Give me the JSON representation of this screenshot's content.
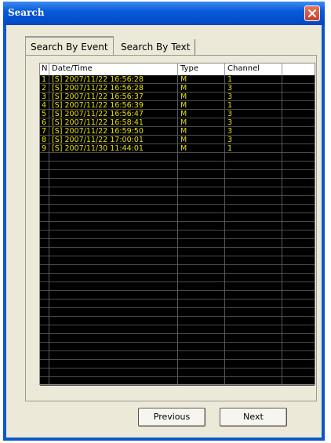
{
  "window": {
    "title": "Search"
  },
  "tabs": [
    {
      "label": "Search By Event",
      "active": true
    },
    {
      "label": "Search By Text",
      "active": false
    }
  ],
  "table": {
    "columns": [
      "N",
      "Date/Time",
      "Type",
      "Channel",
      ""
    ],
    "rows": [
      [
        "1",
        "[S] 2007/11/22 16:56:28",
        "M",
        "1"
      ],
      [
        "2",
        "[S] 2007/11/22 16:56:28",
        "M",
        "3"
      ],
      [
        "3",
        "[S] 2007/11/22 16:56:37",
        "M",
        "3"
      ],
      [
        "4",
        "[S] 2007/11/22 16:56:39",
        "M",
        "1"
      ],
      [
        "5",
        "[S] 2007/11/22 16:56:47",
        "M",
        "3"
      ],
      [
        "6",
        "[S] 2007/11/22 16:58:41",
        "M",
        "3"
      ],
      [
        "7",
        "[S] 2007/11/22 16:59:50",
        "M",
        "3"
      ],
      [
        "8",
        "[S] 2007/11/22 17:00:01",
        "M",
        "3"
      ],
      [
        "9",
        "[S] 2007/11/30 11:44:01",
        "M",
        "1"
      ]
    ],
    "text_color": "#e8e000",
    "background_color": "#000000"
  },
  "buttons": {
    "previous": "Previous",
    "next": "Next"
  },
  "icons": {
    "close": "close-x-icon"
  }
}
